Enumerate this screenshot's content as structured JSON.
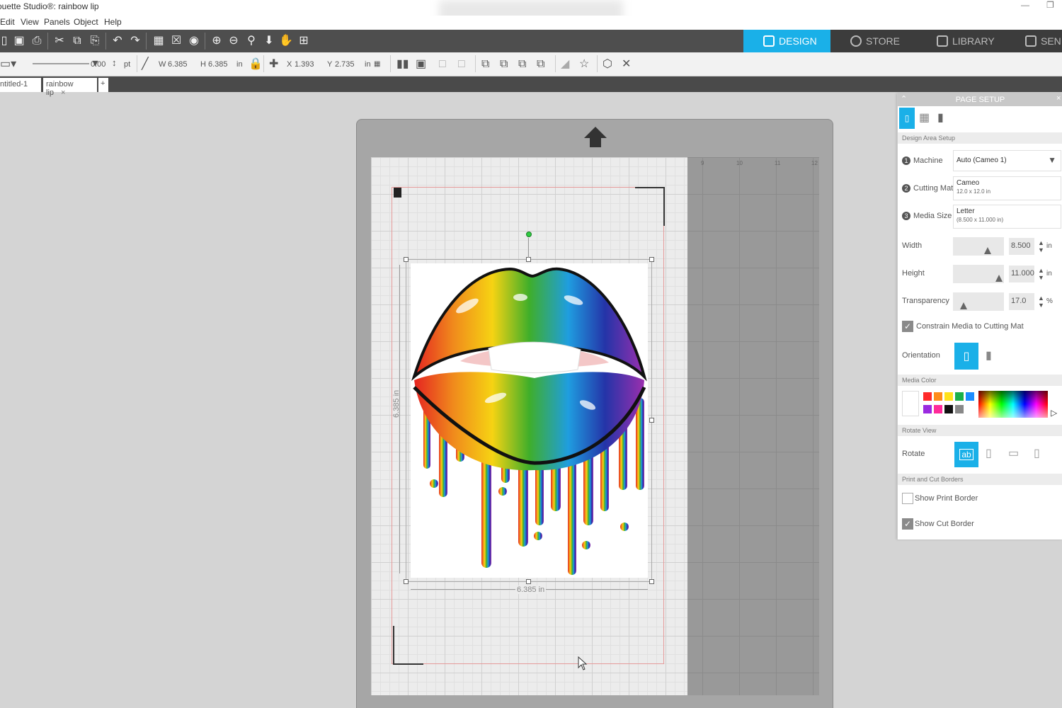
{
  "window": {
    "title": "ouette Studio®: rainbow lip"
  },
  "menu": [
    "Edit",
    "View",
    "Panels",
    "Object",
    "Help"
  ],
  "tabs": {
    "design": "DESIGN",
    "store": "STORE",
    "library": "LIBRARY",
    "send": "SEN"
  },
  "line_toolbar": {
    "line_width": "0.00",
    "line_unit": "pt"
  },
  "size_toolbar": {
    "w_label": "W",
    "w_value": "6.385",
    "h_label": "H",
    "h_value": "6.385",
    "unit": "in"
  },
  "position_toolbar": {
    "x_label": "X",
    "x_value": "1.393",
    "y_label": "Y",
    "y_value": "2.735",
    "unit": "in"
  },
  "doc_tabs": [
    {
      "label": "ntitled-1"
    },
    {
      "label": "rainbow lip"
    }
  ],
  "canvas": {
    "ruler_numbers": [
      "9",
      "10",
      "11",
      "12"
    ],
    "height_dim": "6.385 in",
    "width_dim": "6.385 in"
  },
  "panel": {
    "title": "PAGE SETUP",
    "design_area_setup": "Design Area Setup",
    "machine_label": "Machine",
    "machine_value": "Auto (Cameo 1)",
    "cutting_mat_label": "Cutting Mat",
    "cutting_mat_value": "Cameo",
    "cutting_mat_sub": "12.0 x 12.0 in",
    "media_size_label": "Media Size",
    "media_size_value": "Letter",
    "media_size_sub": "(8.500 x 11.000 in)",
    "width_label": "Width",
    "width_value": "8.500",
    "height_label": "Height",
    "height_value": "11.000",
    "unit_in": "in",
    "transparency_label": "Transparency",
    "transparency_value": "17.0",
    "transparency_unit": "%",
    "constrain_label": "Constrain Media to Cutting Mat",
    "orientation_label": "Orientation",
    "media_color_hdr": "Media Color",
    "rotate_view_hdr": "Rotate View",
    "rotate_label": "Rotate",
    "print_cut_hdr": "Print and Cut Borders",
    "show_print_border": "Show Print Border",
    "show_cut_border": "Show Cut Border",
    "rotate_icon_text": "ab"
  },
  "colors": {
    "accent": "#1ab0e8",
    "toolbar": "#4e4e4e",
    "mat": "#a6a6a6"
  },
  "media_swatches": [
    "#ff2a2a",
    "#ff8c1a",
    "#ffe11a",
    "#1ab04a",
    "#1a8cff",
    "#9a2ae0",
    "#ff2a9a",
    "#111111",
    "#888888"
  ]
}
